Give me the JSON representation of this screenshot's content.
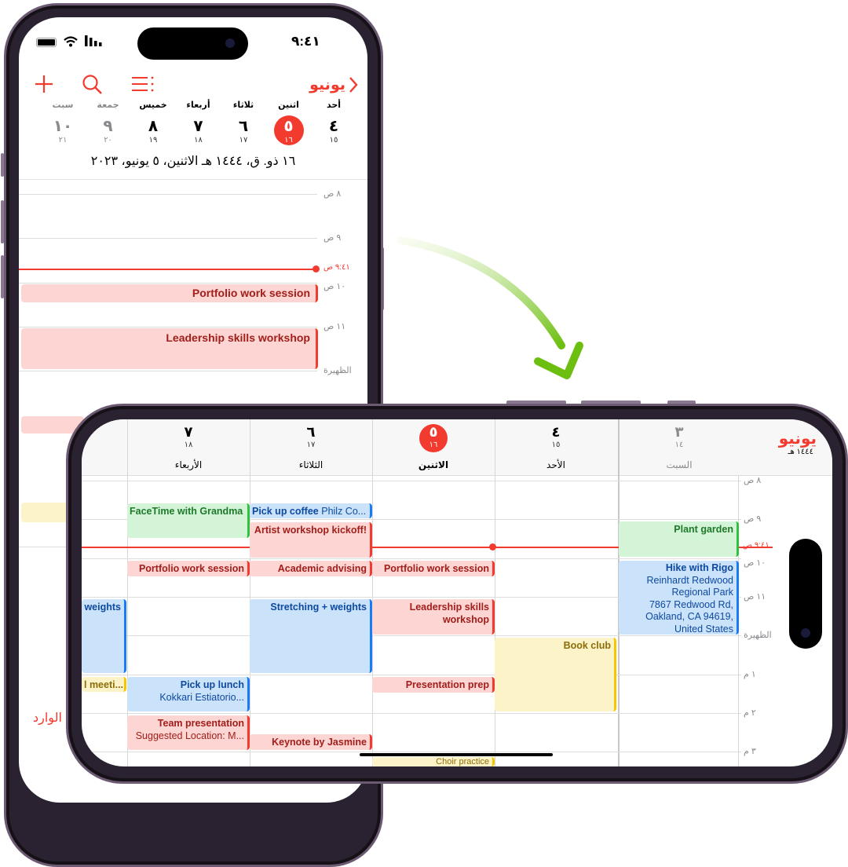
{
  "portrait": {
    "status": {
      "time": "٩:٤١",
      "battery_icon": "battery-icon",
      "wifi_icon": "wifi-icon",
      "signal_icon": "signal-icon"
    },
    "toolbar": {
      "month_label": "يونيو",
      "back_icon": "chevron-right-icon",
      "list_icon": "list-icon",
      "search_icon": "search-icon",
      "add_icon": "plus-icon"
    },
    "week": [
      {
        "day": "أحد",
        "date": "٤",
        "hijri": "١٥"
      },
      {
        "day": "اثنين",
        "date": "٥",
        "hijri": "١٦",
        "selected": true
      },
      {
        "day": "ثلاثاء",
        "date": "٦",
        "hijri": "١٧"
      },
      {
        "day": "أربعاء",
        "date": "٧",
        "hijri": "١٨"
      },
      {
        "day": "خميس",
        "date": "٨",
        "hijri": "١٩"
      },
      {
        "day": "جمعة",
        "date": "٩",
        "hijri": "٢٠"
      },
      {
        "day": "سبت",
        "date": "١٠",
        "hijri": "٢١"
      }
    ],
    "full_date": "١٦ ذو. ق، ١٤٤٤ هـ الاثنين، ٥ يونيو، ٢٠٢٣",
    "hours": [
      "٨ ص",
      "٩ ص",
      "١٠ ص",
      "١١ ص",
      "الظهيرة"
    ],
    "now_label": "٩:٤١ ص",
    "events": [
      "Portfolio work session",
      "Leadership skills workshop"
    ],
    "inbox_label": "الوارد"
  },
  "landscape": {
    "month_label": "يونيو",
    "year_label": "١٤٤٤ هـ",
    "columns": [
      {
        "day": "السبت",
        "date": "٣",
        "hijri": "١٤"
      },
      {
        "day": "الأحد",
        "date": "٤",
        "hijri": "١٥"
      },
      {
        "day": "الاثنين",
        "date": "٥",
        "hijri": "١٦",
        "selected": true
      },
      {
        "day": "الثلاثاء",
        "date": "٦",
        "hijri": "١٧"
      },
      {
        "day": "الأربعاء",
        "date": "٧",
        "hijri": "١٨"
      }
    ],
    "hours": [
      "٨ ص",
      "٩ ص",
      "١٠ ص",
      "١١ ص",
      "الظهيرة",
      "١ م",
      "٢ م",
      "٣ م"
    ],
    "now_label": "٩:٤١ ص",
    "events": {
      "facetime": "FaceTime with Grandma",
      "coffee_title": "Pick up coffee",
      "coffee_loc": "Philz Co...",
      "artist": "Artist workshop kickoff!",
      "portfolio_wed": "Portfolio work session",
      "academic": "Academic advising",
      "portfolio_mon": "Portfolio work session",
      "weights_thu": "weights",
      "stretching": "Stretching + weights",
      "leadership_1": "Leadership skills",
      "leadership_2": "workshop",
      "meeting_thu": "l meeti...",
      "lunch_title": "Pick up lunch",
      "lunch_loc": "Kokkari Estiatorio...",
      "presentation_prep": "Presentation prep",
      "team_title": "Team presentation",
      "team_loc": "Suggested Location: M...",
      "keynote": "Keynote by Jasmine",
      "book_club": "Book club",
      "plant_garden": "Plant garden",
      "hike_title": "Hike with Rigo",
      "hike_loc_1": "Reinhardt Redwood",
      "hike_loc_2": "Regional Park",
      "hike_loc_3": "7867 Redwood Rd,",
      "hike_loc_4": "Oakland, CA 94619,",
      "hike_loc_5": "United States",
      "choir": "Choir practice"
    }
  },
  "colors": {
    "accent": "#f23a2f",
    "arrow": "#7cc61a",
    "red_event": "#fdd5d3",
    "blue_event": "#cbe2fb",
    "green_event": "#d3f4d6",
    "yellow_event": "#fdf3c8"
  }
}
